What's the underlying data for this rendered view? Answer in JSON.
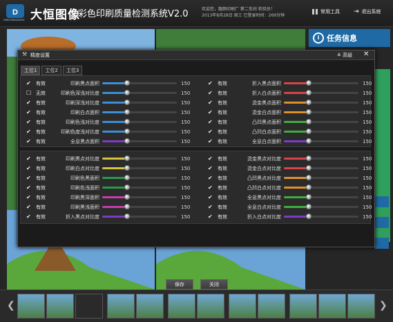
{
  "header": {
    "logo_text": "DINGHENGIMAGE",
    "brand": "大恒图像",
    "subtitle": "彩色印刷质量检测系统V2.0",
    "welcome_line1": "欢迎您，靓颜印刷厂 第二车间 检验员！",
    "welcome_line2": "2013年8月28日  周三  已登录时间：269分钟",
    "common_tools": "常用工具",
    "exit": "退出系统"
  },
  "right_panel": {
    "task_title": "任务信息"
  },
  "dialog": {
    "title": "精度设置",
    "advanced": "高级",
    "tabs": [
      "工位1",
      "工位2",
      "工位3"
    ],
    "save": "保存",
    "close": "关闭",
    "panel1": {
      "left": [
        {
          "status": "有效",
          "checked": true,
          "label": "印刷黑点面积",
          "value": "150",
          "color": "#3d8fd6",
          "fraction": 0.33
        },
        {
          "status": "无效",
          "checked": false,
          "label": "印刷色深浅对比度",
          "value": "150",
          "color": "#3d8fd6",
          "fraction": 0.33
        },
        {
          "status": "有效",
          "checked": true,
          "label": "印刷深浅对比度",
          "value": "150",
          "color": "#3d8fd6",
          "fraction": 0.33
        },
        {
          "status": "有效",
          "checked": true,
          "label": "印刷白点面积",
          "value": "150",
          "color": "#3d8fd6",
          "fraction": 0.33
        },
        {
          "status": "有效",
          "checked": true,
          "label": "印刷色浅对比度",
          "value": "150",
          "color": "#3d8fd6",
          "fraction": 0.33
        },
        {
          "status": "有效",
          "checked": true,
          "label": "印刷色度浅对比度",
          "value": "150",
          "color": "#3d8fd6",
          "fraction": 0.33
        },
        {
          "status": "有效",
          "checked": true,
          "label": "全息黑点面积",
          "value": "150",
          "color": "#7d3cc8",
          "fraction": 0.33
        }
      ],
      "right": [
        {
          "status": "有效",
          "checked": true,
          "label": "折入黑点面积",
          "value": "150",
          "color": "#d9434a",
          "fraction": 0.33
        },
        {
          "status": "有效",
          "checked": true,
          "label": "折入白点面积",
          "value": "150",
          "color": "#d9434a",
          "fraction": 0.33
        },
        {
          "status": "有效",
          "checked": true,
          "label": "烫金黑点面积",
          "value": "150",
          "color": "#e0902a",
          "fraction": 0.33
        },
        {
          "status": "有效",
          "checked": true,
          "label": "烫金白点面积",
          "value": "150",
          "color": "#e0902a",
          "fraction": 0.33
        },
        {
          "status": "有效",
          "checked": true,
          "label": "凸凹黑点面积",
          "value": "150",
          "color": "#3fae3f",
          "fraction": 0.33
        },
        {
          "status": "有效",
          "checked": true,
          "label": "凸凹白点面积",
          "value": "150",
          "color": "#3fae3f",
          "fraction": 0.33
        },
        {
          "status": "有效",
          "checked": true,
          "label": "全息白点面积",
          "value": "150",
          "color": "#7d3cc8",
          "fraction": 0.33
        }
      ]
    },
    "panel2": {
      "left": [
        {
          "status": "有效",
          "checked": true,
          "label": "印刷黑点对比度",
          "value": "150",
          "color": "#d8c43a",
          "fraction": 0.33
        },
        {
          "status": "有效",
          "checked": true,
          "label": "印刷白点对比度",
          "value": "150",
          "color": "#d8c43a",
          "fraction": 0.33
        },
        {
          "status": "有效",
          "checked": true,
          "label": "印刷色黑面积",
          "value": "150",
          "color": "#2a9a4a",
          "fraction": 0.33
        },
        {
          "status": "有效",
          "checked": true,
          "label": "印刷色浅面积",
          "value": "150",
          "color": "#2a9a4a",
          "fraction": 0.33
        },
        {
          "status": "有效",
          "checked": true,
          "label": "印刷黑深面积",
          "value": "150",
          "color": "#c83cae",
          "fraction": 0.33
        },
        {
          "status": "有效",
          "checked": true,
          "label": "印刷黑浅面积",
          "value": "150",
          "color": "#c83cae",
          "fraction": 0.33
        },
        {
          "status": "有效",
          "checked": true,
          "label": "折入黑点对比度",
          "value": "150",
          "color": "#7d3cc8",
          "fraction": 0.33
        }
      ],
      "right": [
        {
          "status": "有效",
          "checked": true,
          "label": "烫金黑点对比度",
          "value": "150",
          "color": "#d9434a",
          "fraction": 0.33
        },
        {
          "status": "有效",
          "checked": true,
          "label": "烫金白点对比度",
          "value": "150",
          "color": "#d9434a",
          "fraction": 0.33
        },
        {
          "status": "有效",
          "checked": true,
          "label": "凸凹黑点对比度",
          "value": "150",
          "color": "#e0902a",
          "fraction": 0.33
        },
        {
          "status": "有效",
          "checked": true,
          "label": "凸凹白点对比度",
          "value": "150",
          "color": "#e0902a",
          "fraction": 0.33
        },
        {
          "status": "有效",
          "checked": true,
          "label": "全息黑点对比度",
          "value": "150",
          "color": "#3fae3f",
          "fraction": 0.33
        },
        {
          "status": "有效",
          "checked": true,
          "label": "全息白点对比度",
          "value": "150",
          "color": "#3fae3f",
          "fraction": 0.33
        },
        {
          "status": "有效",
          "checked": true,
          "label": "折入白点对比度",
          "value": "150",
          "color": "#7d3cc8",
          "fraction": 0.33
        }
      ]
    }
  }
}
